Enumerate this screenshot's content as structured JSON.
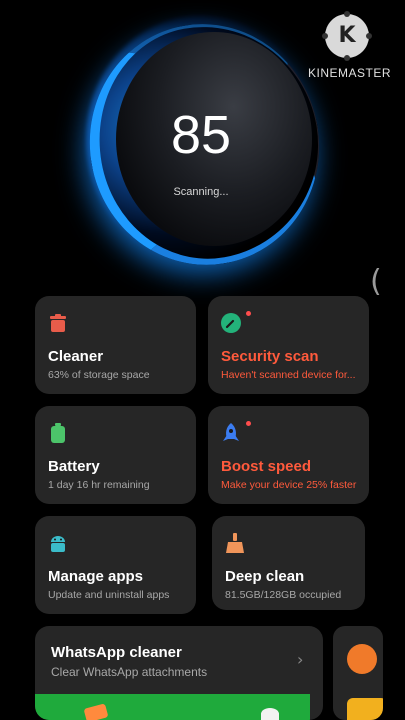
{
  "scan": {
    "score": "85",
    "status": "Scanning..."
  },
  "watermark": {
    "text": "KINEMASTER",
    "logo_letter": "K"
  },
  "edge_glyph": "(",
  "cards": [
    {
      "id": "cleaner",
      "title": "Cleaner",
      "subtitle": "63% of storage space",
      "icon": "trash-icon",
      "color": "#e85c4a"
    },
    {
      "id": "security",
      "title": "Security scan",
      "subtitle": "Haven't scanned device for...",
      "icon": "shield-clock-icon",
      "color": "#23b27a"
    },
    {
      "id": "battery",
      "title": "Battery",
      "subtitle": "1 day 16 hr  remaining",
      "icon": "battery-icon",
      "color": "#4cc46a"
    },
    {
      "id": "boost",
      "title": "Boost speed",
      "subtitle": "Make your device 25% faster",
      "icon": "rocket-icon",
      "color": "#3b7cf0"
    },
    {
      "id": "manage",
      "title": "Manage apps",
      "subtitle": "Update and uninstall apps",
      "icon": "android-icon",
      "color": "#3bbcc9"
    },
    {
      "id": "deep",
      "title": "Deep clean",
      "subtitle": "81.5GB/128GB occupied",
      "icon": "broom-icon",
      "color": "#f0955a"
    }
  ],
  "whatsapp": {
    "title": "WhatsApp cleaner",
    "subtitle": "Clear WhatsApp attachments"
  },
  "colors": {
    "background": "#000000",
    "card": "#262626",
    "alert": "#ff5a3c",
    "accent_blue": "#1e9bff"
  }
}
